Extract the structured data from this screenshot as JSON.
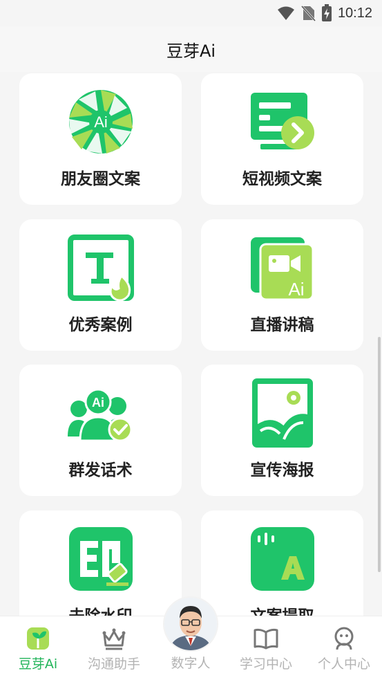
{
  "status_bar": {
    "time": "10:12",
    "icons": [
      "wifi-icon",
      "no-sim-icon",
      "battery-charging-icon"
    ]
  },
  "header": {
    "title": "豆芽Ai"
  },
  "cards": [
    {
      "label": "朋友圈文案",
      "icon": "camera-aperture-ai-icon"
    },
    {
      "label": "短视频文案",
      "icon": "video-script-icon"
    },
    {
      "label": "优秀案例",
      "icon": "text-fire-icon"
    },
    {
      "label": "直播讲稿",
      "icon": "live-camera-ai-icon"
    },
    {
      "label": "群发话术",
      "icon": "group-message-icon"
    },
    {
      "label": "宣传海报",
      "icon": "poster-image-icon"
    },
    {
      "label": "去除水印",
      "icon": "remove-watermark-icon"
    },
    {
      "label": "文案提取",
      "icon": "text-extract-icon"
    }
  ],
  "bottom_nav": {
    "items": [
      {
        "label": "豆芽Ai",
        "icon": "sprout-icon",
        "active": true
      },
      {
        "label": "沟通助手",
        "icon": "crown-icon",
        "active": false
      },
      {
        "label": "数字人",
        "icon": "digital-human-avatar",
        "active": false
      },
      {
        "label": "学习中心",
        "icon": "book-icon",
        "active": false
      },
      {
        "label": "个人中心",
        "icon": "person-icon",
        "active": false
      }
    ]
  },
  "colors": {
    "accent": "#22b45a",
    "icon_green": "#1fc46a",
    "icon_lime": "#a8dc55",
    "inactive": "#b3b3b3"
  }
}
